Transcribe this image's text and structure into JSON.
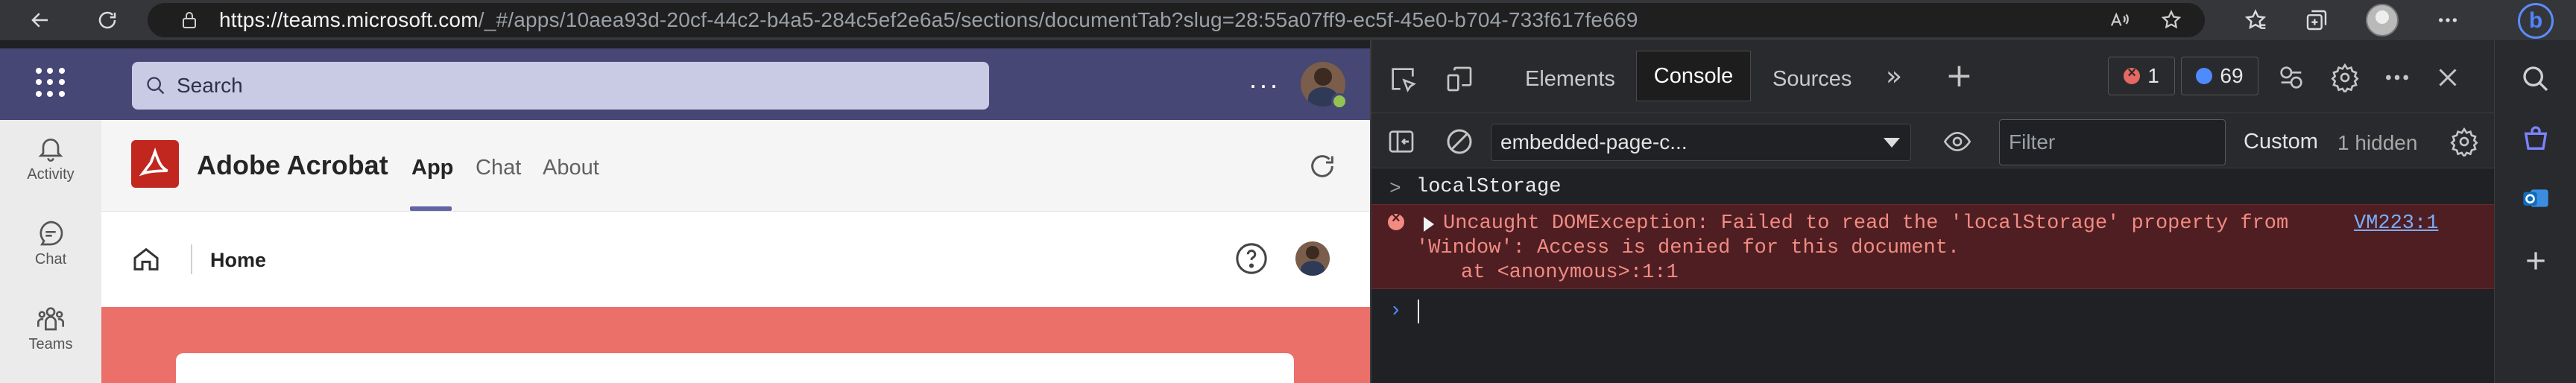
{
  "browser": {
    "url_host": "https://teams.microsoft.com",
    "url_path": "/_#/apps/10aea93d-20cf-44c2-b4a5-284c5ef2e6a5/sections/documentTab?slug=28:55a07ff9-ec5f-45e0-b704-733f617fe669"
  },
  "teams": {
    "search_placeholder": "Search",
    "more_label": "···",
    "rail": [
      {
        "label": "Activity",
        "icon": "bell-icon"
      },
      {
        "label": "Chat",
        "icon": "chat-icon"
      },
      {
        "label": "Teams",
        "icon": "teams-icon"
      }
    ],
    "app_title": "Adobe Acrobat",
    "tabs": [
      {
        "label": "App",
        "active": true
      },
      {
        "label": "Chat",
        "active": false
      },
      {
        "label": "About",
        "active": false
      }
    ],
    "home_label": "Home",
    "colors": {
      "header": "#464775",
      "accent": "#6264a7",
      "banner": "#ec706a",
      "acrobat": "#c1271f"
    }
  },
  "devtools": {
    "tabs": [
      "Elements",
      "Console",
      "Sources"
    ],
    "active_tab": "Console",
    "error_count": "1",
    "message_count": "69",
    "context": "embedded-page-c...",
    "filter_placeholder": "Filter",
    "custom_label": "Custom",
    "hidden_label": "1 hidden",
    "console": {
      "input_line": "localStorage",
      "error_line1": "Uncaught DOMException: Failed to read the 'localStorage' property from",
      "error_line2": "'Window': Access is denied for this document.",
      "error_line3": "at <anonymous>:1:1",
      "error_source": "VM223:1"
    }
  }
}
